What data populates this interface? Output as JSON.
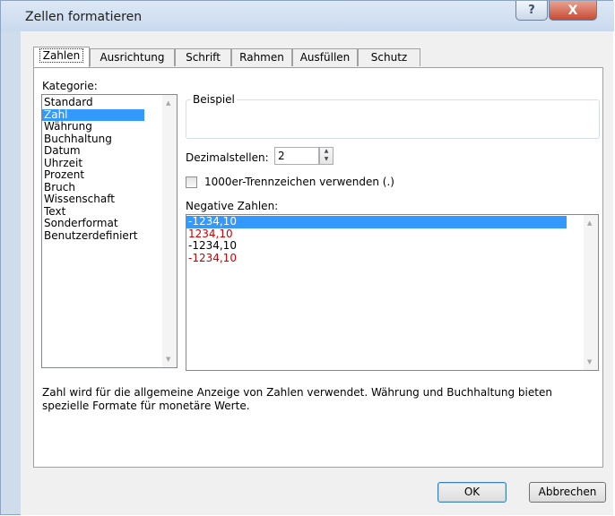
{
  "window": {
    "title": "Zellen formatieren",
    "help_label": "?",
    "close_label": "X"
  },
  "tabs": [
    {
      "label": "Zahlen"
    },
    {
      "label": "Ausrichtung"
    },
    {
      "label": "Schrift"
    },
    {
      "label": "Rahmen"
    },
    {
      "label": "Ausfüllen"
    },
    {
      "label": "Schutz"
    }
  ],
  "category": {
    "label": "Kategorie:",
    "items": [
      "Standard",
      "Zahl",
      "Währung",
      "Buchhaltung",
      "Datum",
      "Uhrzeit",
      "Prozent",
      "Bruch",
      "Wissenschaft",
      "Text",
      "Sonderformat",
      "Benutzerdefiniert"
    ],
    "selected": "Zahl"
  },
  "sample": {
    "label": "Beispiel"
  },
  "decimals": {
    "label": "Dezimalstellen:",
    "value": "2"
  },
  "thousands": {
    "label": "1000er-Trennzeichen verwenden (.)",
    "checked": false
  },
  "negative": {
    "label": "Negative Zahlen:",
    "items": [
      "-1234,10",
      "1234,10",
      "-1234,10",
      "-1234,10"
    ],
    "item_colors": [
      "#000000",
      "#cc0000",
      "#000000",
      "#cc0000"
    ],
    "selected_index": 0
  },
  "description": "Zahl wird für die allgemeine Anzeige von Zahlen verwendet. Währung und Buchhaltung bieten spezielle Formate für monetäre Werte.",
  "buttons": {
    "ok": "OK",
    "cancel": "Abbrechen"
  },
  "colors": {
    "selection": "#3399ff",
    "negative_red": "#cc0000",
    "close_button": "#c74a32"
  }
}
